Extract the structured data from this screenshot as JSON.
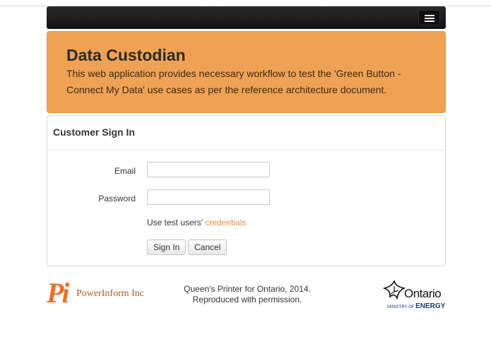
{
  "nav": {
    "toggle_icon": "hamburger-menu-icon"
  },
  "jumbotron": {
    "title": "Data Custodian",
    "description": "This web application provides necessary workflow to test the 'Green Button - Connect My Data' use cases as per the reference architecture document.",
    "background_color": "#f0a254"
  },
  "signin": {
    "heading": "Customer Sign In",
    "email_label": "Email",
    "email_value": "",
    "password_label": "Password",
    "password_value": "",
    "hint_text": "Use test users'",
    "hint_link": "credentials",
    "signin_button": "Sign In",
    "cancel_button": "Cancel"
  },
  "footer": {
    "powerinform_mark": "Pi",
    "powerinform_name": "PowerInform Inc",
    "copyright_line1": "Queen's Printer for Ontario, 2014.",
    "copyright_line2": "Reproduced with permission.",
    "ontario_name": "Ontario",
    "ministry_prefix": "MINISTRY OF",
    "ministry_name": "ENERGY",
    "accent_color": "#e8702a"
  }
}
